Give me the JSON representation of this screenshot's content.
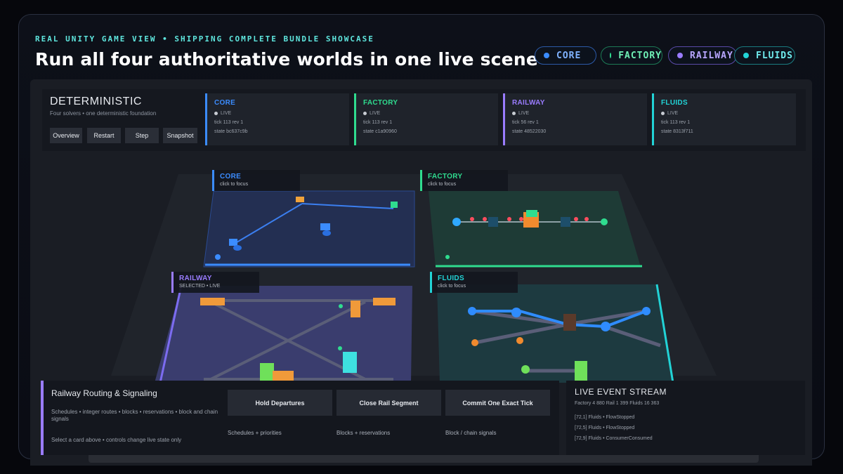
{
  "header": {
    "kicker": "REAL UNITY GAME VIEW • SHIPPING COMPLETE BUNDLE SHOWCASE",
    "title": "Run all four authoritative worlds in one live scene"
  },
  "chips": [
    {
      "label": "CORE",
      "color": "#3b8cff"
    },
    {
      "label": "FACTORY",
      "color": "#2fdc8f"
    },
    {
      "label": "RAILWAY",
      "color": "#9a7cff"
    },
    {
      "label": "FLUIDS",
      "color": "#22d3d6"
    }
  ],
  "hud": {
    "title": "DETERMINISTIC",
    "subtitle": "Four solvers • one deterministic foundation",
    "buttons": [
      "Overview",
      "Restart",
      "Step",
      "Snapshot"
    ],
    "worlds": [
      {
        "name": "CORE",
        "status": "LIVE",
        "tick": "tick 113   rev 1",
        "state": "state bc637c9b",
        "color": "#3b8cff"
      },
      {
        "name": "FACTORY",
        "status": "LIVE",
        "tick": "tick 113   rev 1",
        "state": "state c1a90960",
        "color": "#2fdc8f"
      },
      {
        "name": "RAILWAY",
        "status": "LIVE",
        "tick": "tick 56   rev 1",
        "state": "state 48522030",
        "color": "#9a7cff"
      },
      {
        "name": "FLUIDS",
        "status": "LIVE",
        "tick": "tick 113   rev 1",
        "state": "state 8313f711",
        "color": "#22d3d6"
      }
    ]
  },
  "quadrants": {
    "core": {
      "name": "CORE",
      "sub": "click to focus"
    },
    "factory": {
      "name": "FACTORY",
      "sub": "click to focus"
    },
    "railway": {
      "name": "RAILWAY",
      "sub": "SELECTED • LIVE"
    },
    "fluids": {
      "name": "FLUIDS",
      "sub": "click to focus"
    }
  },
  "panel": {
    "title": "Railway Routing & Signaling",
    "description": "Schedules • integer routes • blocks • reservations • block and chain signals",
    "hint": "Select a card above • controls change live state only",
    "actions": [
      {
        "label": "Hold Departures",
        "caption": "Schedules + priorities"
      },
      {
        "label": "Close Rail Segment",
        "caption": "Blocks + reservations"
      },
      {
        "label": "Commit One Exact Tick",
        "caption": "Block / chain signals"
      }
    ]
  },
  "event_stream": {
    "title": "LIVE EVENT STREAM",
    "counts": "Factory 4 880   Rail 1 399   Fluids 16 363",
    "events": [
      "[72,1] Fluids • FlowStopped",
      "[72,5] Fluids • FlowStopped",
      "[72,9] Fluids • ConsumerConsumed"
    ]
  }
}
